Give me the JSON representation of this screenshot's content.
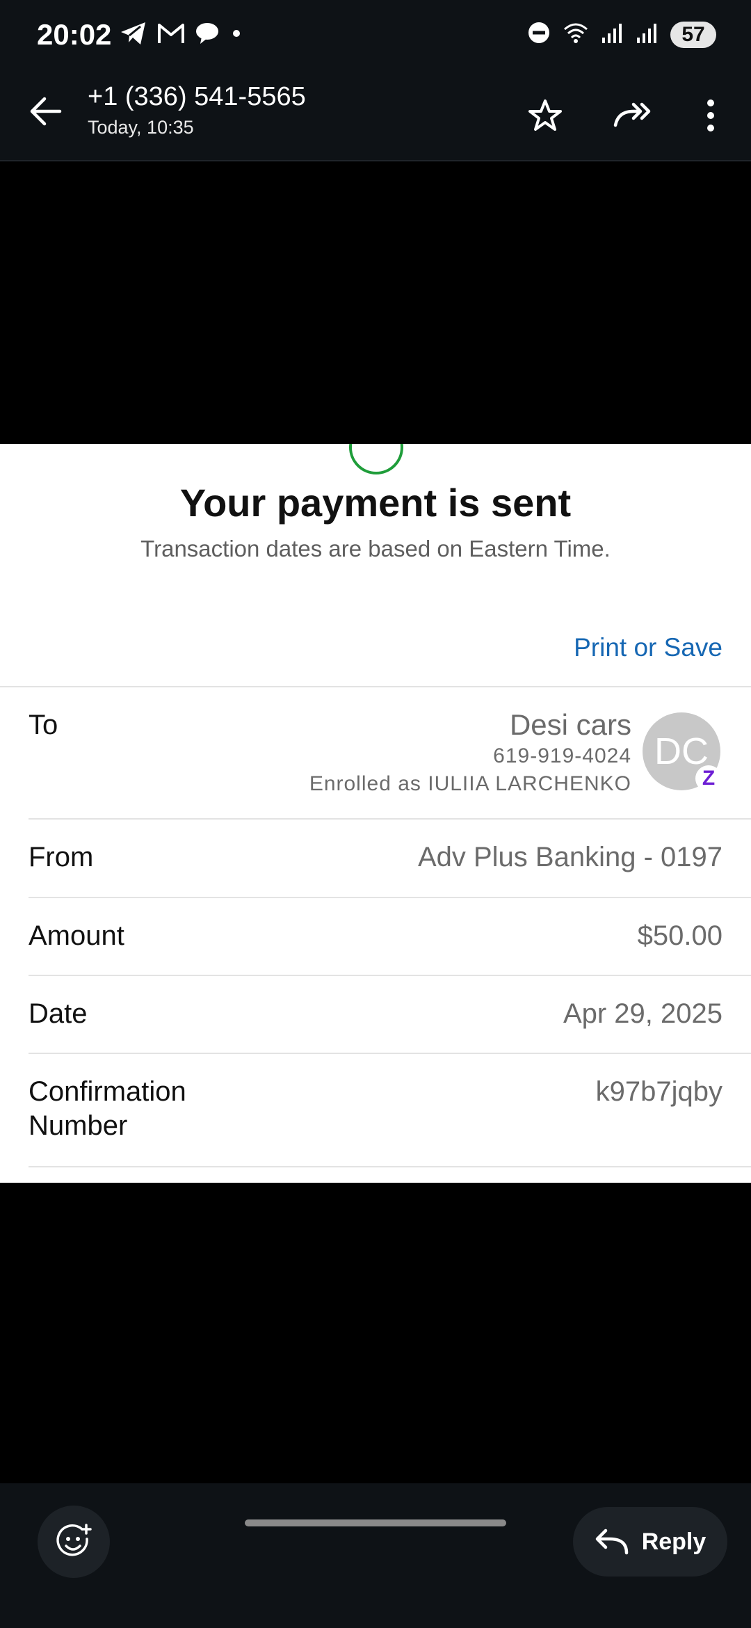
{
  "status_bar": {
    "time": "20:02",
    "battery": "57",
    "left_icons": [
      "telegram-icon",
      "gmail-icon",
      "chat-icon",
      "dot-icon"
    ],
    "right_icons": [
      "do-not-disturb-icon",
      "wifi-icon",
      "signal-icon",
      "signal-icon"
    ]
  },
  "header": {
    "title": "+1 (336) 541-5565",
    "subtitle": "Today, 10:35"
  },
  "receipt": {
    "heading": "Your payment is sent",
    "note": "Transaction dates are based on Eastern Time.",
    "print_link": "Print or Save",
    "to": {
      "label": "To",
      "name": "Desi cars",
      "phone": "619-919-4024",
      "enrolled": "Enrolled as IULIIA LARCHENKO",
      "avatar_initials": "DC",
      "badge": "Z"
    },
    "from": {
      "label": "From",
      "value": "Adv Plus Banking - 0197"
    },
    "amount": {
      "label": "Amount",
      "value": "$50.00"
    },
    "date": {
      "label": "Date",
      "value": "Apr 29, 2025"
    },
    "confirmation": {
      "label_line1": "Confirmation",
      "label_line2": "Number",
      "value": "k97b7jqby"
    }
  },
  "bottom_bar": {
    "reply_label": "Reply"
  },
  "colors": {
    "link": "#1667b3",
    "success": "#1f9d3a",
    "zelle": "#6d1ed4",
    "bar_background": "#0e1216"
  }
}
